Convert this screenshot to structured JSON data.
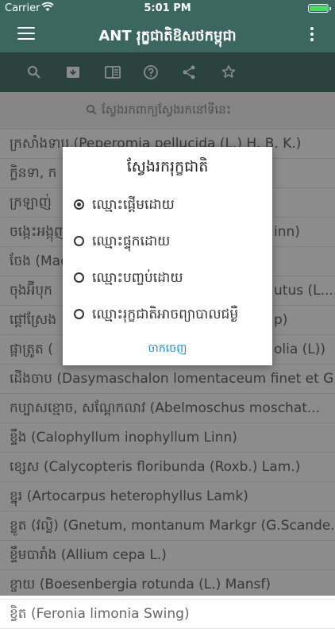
{
  "status_bar": {
    "carrier": "Carrier",
    "time": "5:01 PM",
    "battery_level": 1.0
  },
  "app_bar": {
    "title": "ANT រុក្ខជាតិឱសថកម្ពុជា"
  },
  "toolbar": {
    "icons": [
      "search-icon",
      "archive-icon",
      "book-icon",
      "help-icon",
      "share-icon",
      "star-icon"
    ]
  },
  "search": {
    "placeholder": "ស្វែងរកពាក្យស្វែងរកនៅទីនេះ"
  },
  "list": {
    "items": [
      "ក្រសាំងទាប (Peperomia pellucida (L.) H. B. K.)",
      "ក្លិនទា, ក",
      "ក្រឡាញ់",
      "ចង្កេះអង្កុញ",
      "ចែង (Mac",
      "ចុងអ៊ីបុក",
      "ផ្ដៅស្រែង",
      "ផ្កាត្រូត (",
      "ដើងចាប (Dasymaschalon lomentaceum finet et G...",
      "កប្បាសខ្មោច, សណ្ដែកលាវ (Abelmoschus moschat...",
      "ខ្ទឹង (Calophyllum inophyllum Linn)",
      "ខ្សេស (Calycopteris floribunda (Roxb.) Lam.)",
      "ខ្នុរ (Artocarpus heterophyllus Lamk)",
      "ខ្លូត (វល្លិ) (Gnetum, montanum Markgr (G.Scande...",
      "ខ្ទឹមបារាំង (Allium cepa L.)",
      "ខ្ចាយ (Boesenbergia rotunda (L.) Mansf)",
      "ខ្វិត (Feronia limonia Swing)"
    ],
    "partial_tail": [
      {
        "index": 1,
        "suffix": ""
      },
      {
        "index": 3,
        "suffix": "inn)"
      },
      {
        "index": 5,
        "suffix": "utus (L...."
      },
      {
        "index": 6,
        "suffix": "p)"
      },
      {
        "index": 7,
        "suffix": "olia (L))"
      }
    ]
  },
  "dialog": {
    "title": "ស្វែងរករុក្ខជាតិ",
    "options": [
      {
        "label": "ឈ្មោះផ្ដើមដោយ",
        "selected": true
      },
      {
        "label": "ឈ្មោះផ្ទុកដោយ",
        "selected": false
      },
      {
        "label": "ឈ្មោះបញ្ចប់ដោយ",
        "selected": false
      },
      {
        "label": "ឈ្មោះរុក្ខជាតិអាចព្យាបាលជម្ងឺ",
        "selected": false
      }
    ],
    "cancel_label": "ចាកចេញ"
  }
}
